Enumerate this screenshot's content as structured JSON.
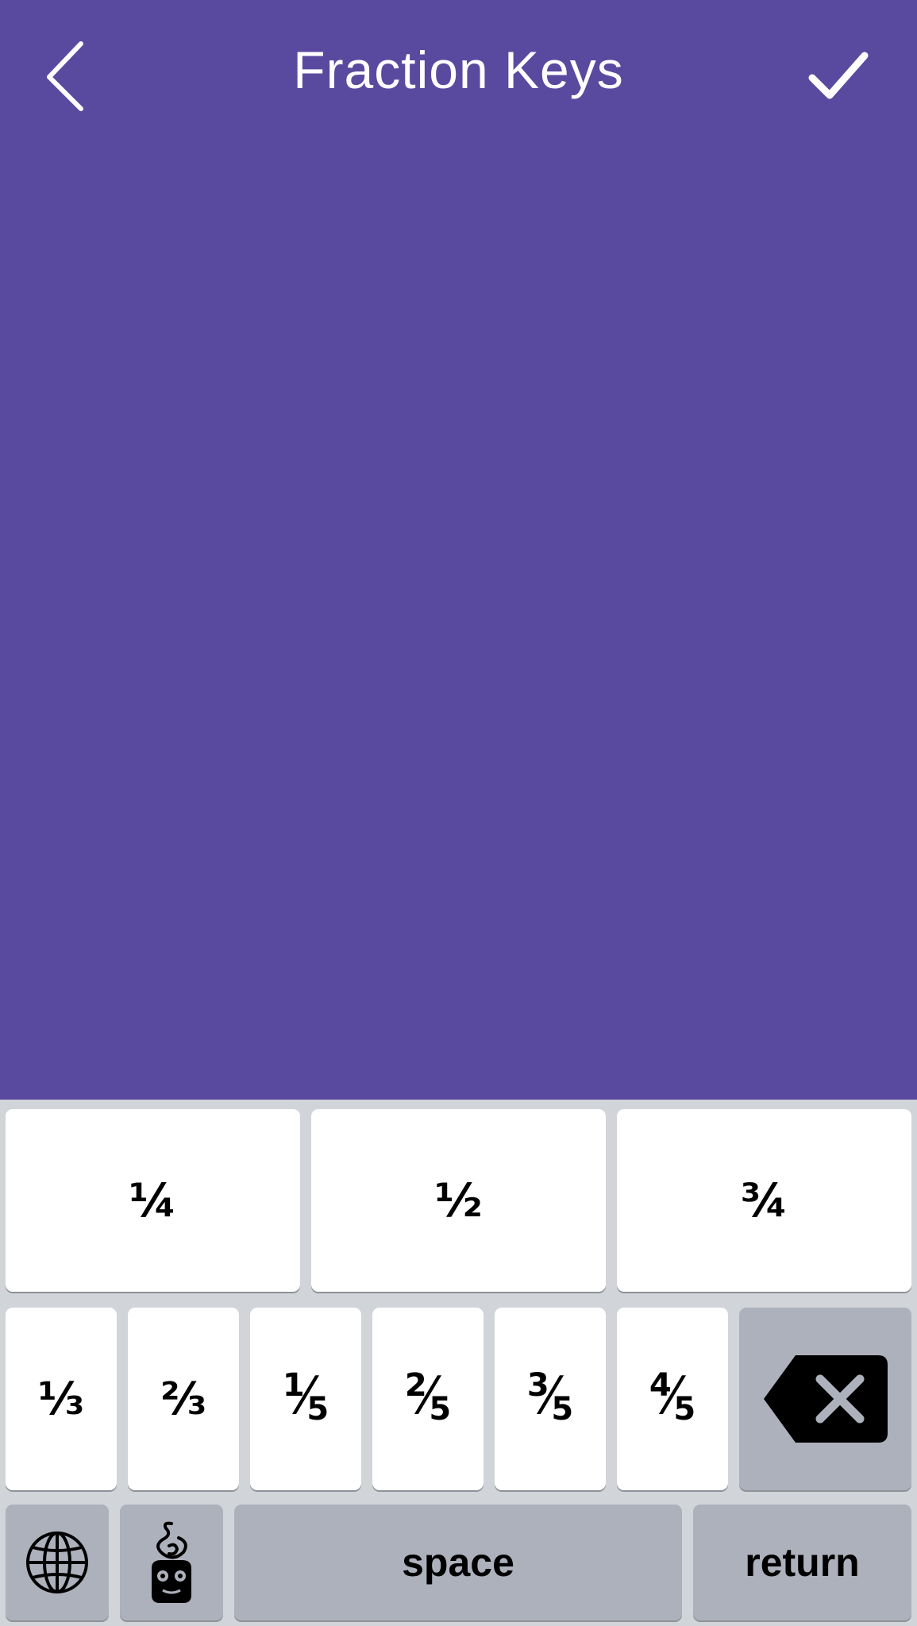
{
  "nav": {
    "title": "Fraction Keys",
    "back_icon": "chevron-left-icon",
    "done_icon": "checkmark-icon"
  },
  "colors": {
    "background": "#5a4a9f",
    "keyboard_bg": "#d1d4d9",
    "key_light": "#ffffff",
    "key_dark": "#adb1bc"
  },
  "keyboard": {
    "row1": [
      "¼",
      "½",
      "¾"
    ],
    "row2": [
      "⅓",
      "⅔"
    ],
    "row2_fifths": [
      {
        "num": "1",
        "den": "5"
      },
      {
        "num": "2",
        "den": "5"
      },
      {
        "num": "3",
        "den": "5"
      },
      {
        "num": "4",
        "den": "5"
      }
    ],
    "backspace_icon": "backspace-icon",
    "globe_icon": "globe-icon",
    "app_icon": "swirl-creature-icon",
    "space_label": "space",
    "return_label": "return"
  }
}
